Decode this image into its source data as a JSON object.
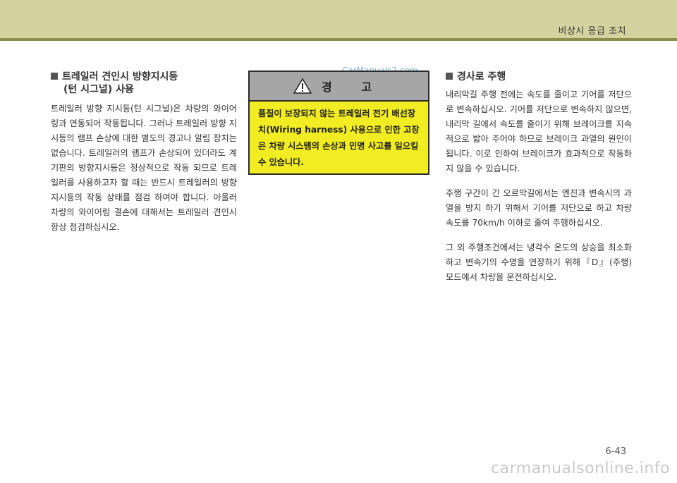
{
  "header": {
    "section_title": "비상시 응급 조치"
  },
  "left": {
    "heading_line1": "트레일러 견인시 방향지시등",
    "heading_line2": "(턴 시그널) 사용",
    "paragraph": "트레일러 방향 지시등(턴 시그널)은 차량의 와이어링과 연동되어 작동됩니다. 그러나 트레일러 방향 지시등의 램프 손상에 대한 별도의 경고나 알림 장치는 없습니다. 트레일러의 램프가 손상되어 있더라도 계기판의 방향지시등은 정상적으로 작동 되므로 트레일러를 사용하고자 할 때는 반드시 트레일러의 방향지시등의 작동 상태를 점검 하여야 합니다. 아울러 차량의 와이어링 결손에 대해서는 트레일러 견인시 항상 점검하십시오."
  },
  "warning": {
    "title": "경 고",
    "body": "품질이 보장되지 않는 트레일러 전기 배선장치(Wiring harness) 사용으로 인한 고장은 차량 시스템의 손상과 인명 사고를 일으킬 수 있습니다."
  },
  "right": {
    "heading": "경사로 주행",
    "paragraphs": [
      "내리막길 주행 전에는 속도를 줄이고 기어를 저단으로 변속하십시오. 기어를 저단으로 변속하지 않으면, 내리막 길에서 속도를 줄이기 위해 브레이크를 지속적으로 밟아 주어야 하므로 브레이크 과열의 원인이 됩니다. 이로 인하여 브레이크가 효과적으로 작동하지 않을 수 있습니다.",
      "주행 구간이 긴 오르막길에서는 엔진과 변속시의 과열을 방지 하기 위해서 기어를 저단으로 하고 차량 속도를 70km/h 이하로 줄여 주행하십시오.",
      "그 외 주행조건에서는 냉각수 온도의 상승을 최소화하고 변속기의 수명을 연장하기 위해『D』(주행) 모드에서 차량을 운전하십시오."
    ]
  },
  "footer": {
    "page_number": "6-43"
  },
  "watermarks": {
    "top": "CarManuals2.com",
    "bottom": "carmanualsonline.info"
  },
  "colors": {
    "header_band": "#d4d3a0",
    "header_line": "#8e8c4a",
    "warning_bg": "#f2ed22",
    "warning_head": "#a6a6a6"
  },
  "icons": {
    "warning": "warning-triangle-icon",
    "bullet": "square-bullet-icon"
  }
}
